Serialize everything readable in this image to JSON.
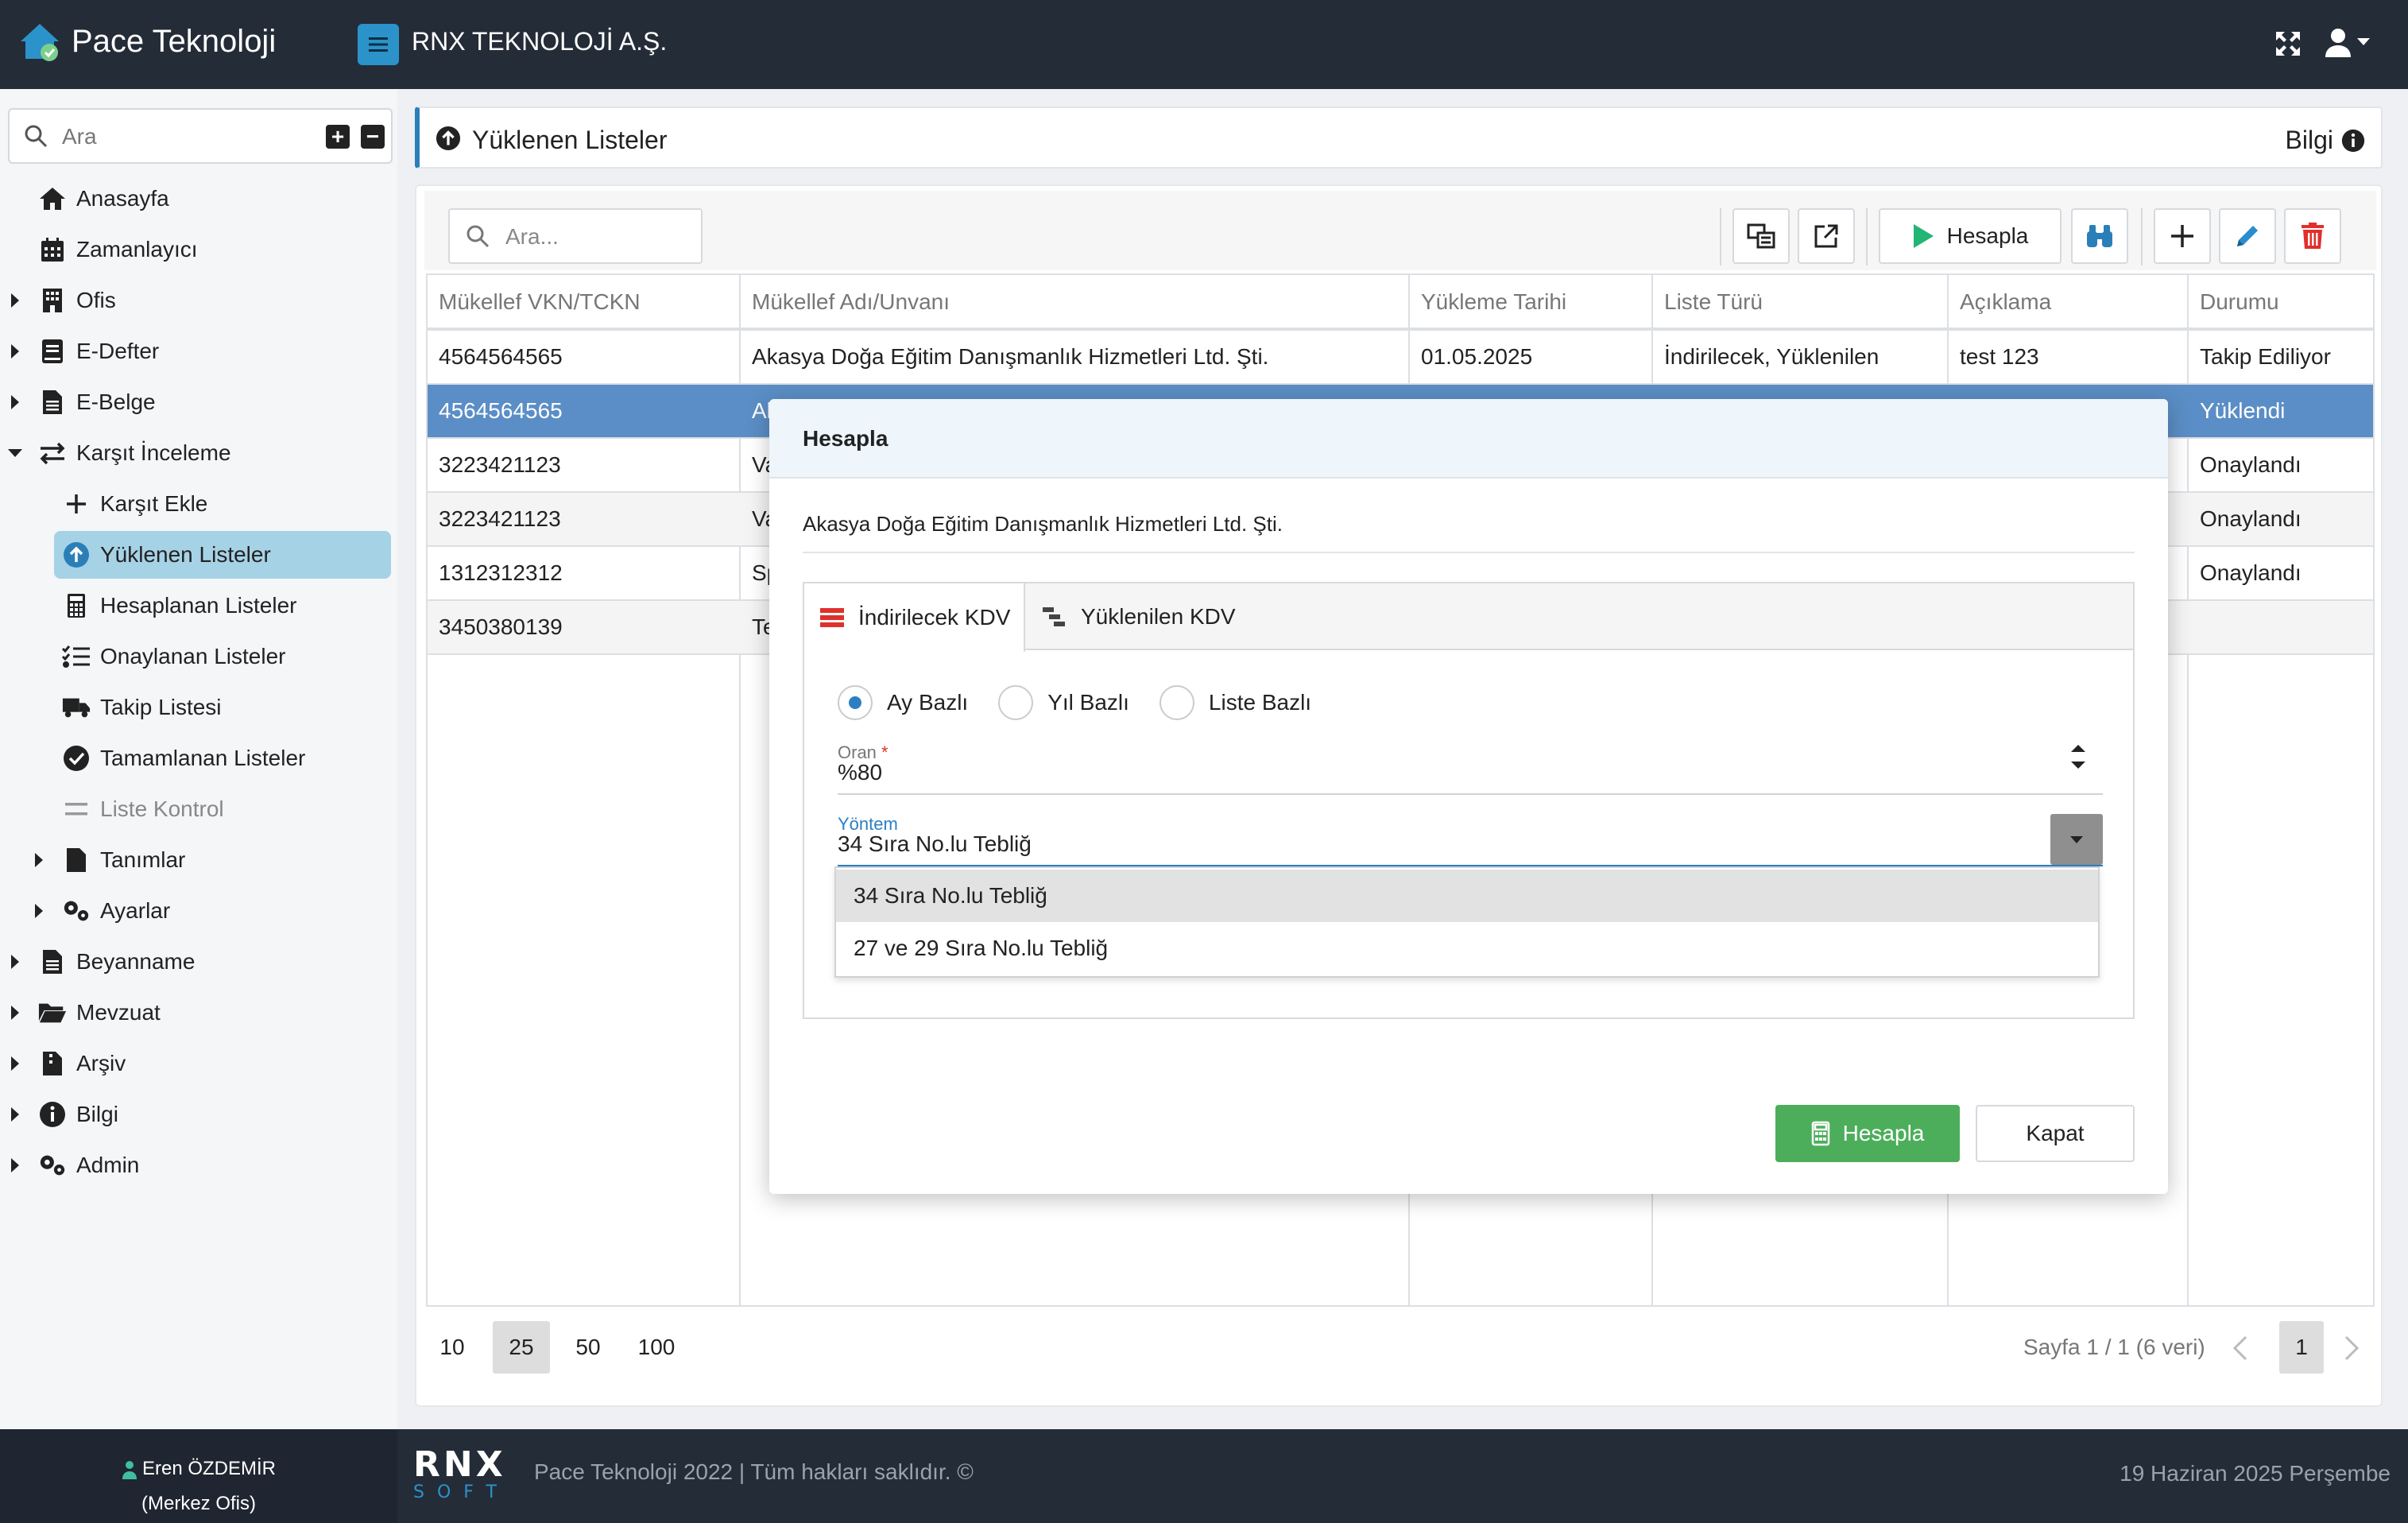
{
  "app": {
    "brand": "Pace Teknoloji",
    "company": "RNX TEKNOLOJİ A.Ş."
  },
  "sidebar": {
    "search_placeholder": "Ara",
    "items": [
      {
        "label": "Anasayfa",
        "icon": "home-icon"
      },
      {
        "label": "Zamanlayıcı",
        "icon": "calendar-icon"
      },
      {
        "label": "Ofis",
        "icon": "building-icon"
      },
      {
        "label": "E-Defter",
        "icon": "book-icon"
      },
      {
        "label": "E-Belge",
        "icon": "file-icon"
      },
      {
        "label": "Karşıt İnceleme",
        "icon": "exchange-icon"
      },
      {
        "label": "Karşıt Ekle",
        "icon": "plus-icon"
      },
      {
        "label": "Yüklenen Listeler",
        "icon": "upload-circle-icon"
      },
      {
        "label": "Hesaplanan Listeler",
        "icon": "calculator-icon"
      },
      {
        "label": "Onaylanan Listeler",
        "icon": "checklist-icon"
      },
      {
        "label": "Takip Listesi",
        "icon": "truck-icon"
      },
      {
        "label": "Tamamlanan Listeler",
        "icon": "check-circle-icon"
      },
      {
        "label": "Liste Kontrol",
        "icon": "equals-icon"
      },
      {
        "label": "Tanımlar",
        "icon": "document-icon"
      },
      {
        "label": "Ayarlar",
        "icon": "gears-icon"
      },
      {
        "label": "Beyanname",
        "icon": "document-icon"
      },
      {
        "label": "Mevzuat",
        "icon": "folder-open-icon"
      },
      {
        "label": "Arşiv",
        "icon": "archive-file-icon"
      },
      {
        "label": "Bilgi",
        "icon": "info-circle-icon"
      },
      {
        "label": "Admin",
        "icon": "gears-icon"
      }
    ]
  },
  "page": {
    "title": "Yüklenen Listeler",
    "info_label": "Bilgi"
  },
  "toolbar": {
    "search_placeholder": "Ara...",
    "calculate_label": "Hesapla"
  },
  "table": {
    "columns": [
      "Mükellef VKN/TCKN",
      "Mükellef Adı/Unvanı",
      "Yükleme Tarihi",
      "Liste Türü",
      "Açıklama",
      "Durumu"
    ],
    "rows": [
      [
        "4564564565",
        "Akasya Doğa Eğitim Danışmanlık Hizmetleri Ltd. Şti.",
        "01.05.2025",
        "İndirilecek, Yüklenilen",
        "test 123",
        "Takip Ediliyor"
      ],
      [
        "4564564565",
        "Al",
        "",
        "",
        "",
        "Yüklendi"
      ],
      [
        "3223421123",
        "Va",
        "",
        "",
        "",
        "Onaylandı"
      ],
      [
        "3223421123",
        "Va",
        "",
        "",
        "",
        "Onaylandı"
      ],
      [
        "1312312312",
        "Sp",
        "",
        "",
        "",
        "Onaylandı"
      ],
      [
        "3450380139",
        "Te",
        "",
        "",
        "",
        ""
      ]
    ]
  },
  "pager": {
    "sizes": [
      "10",
      "25",
      "50",
      "100"
    ],
    "active_size": "25",
    "info": "Sayfa 1 / 1 (6 veri)",
    "current_page": "1"
  },
  "modal": {
    "title": "Hesapla",
    "company": "Akasya Doğa Eğitim Danışmanlık Hizmetleri Ltd. Şti.",
    "tabs": [
      "İndirilecek KDV",
      "Yüklenilen KDV"
    ],
    "radios": [
      "Ay Bazlı",
      "Yıl Bazlı",
      "Liste Bazlı"
    ],
    "rate_label": "Oran",
    "rate_required": "*",
    "rate_value": "%80",
    "method_label": "Yöntem",
    "method_value": "34 Sıra No.lu Tebliğ",
    "method_options": [
      "34 Sıra No.lu Tebliğ",
      "27 ve 29 Sıra No.lu Tebliğ"
    ],
    "calculate_label": "Hesapla",
    "close_label": "Kapat"
  },
  "footer": {
    "user_name": "Eren ÖZDEMİR",
    "user_office": "(Merkez Ofis)",
    "logo_top": "RNX",
    "logo_bottom": "SOFT",
    "copyright": "Pace Teknoloji 2022 | Tüm hakları saklıdır. ©",
    "date": "19 Haziran 2025 Perşembe"
  },
  "colors": {
    "topbar": "#242c38",
    "accent": "#2b93c9",
    "selected_row": "#5b8ec6",
    "success": "#4cae5b",
    "danger": "#e0302b",
    "play": "#22b573"
  }
}
